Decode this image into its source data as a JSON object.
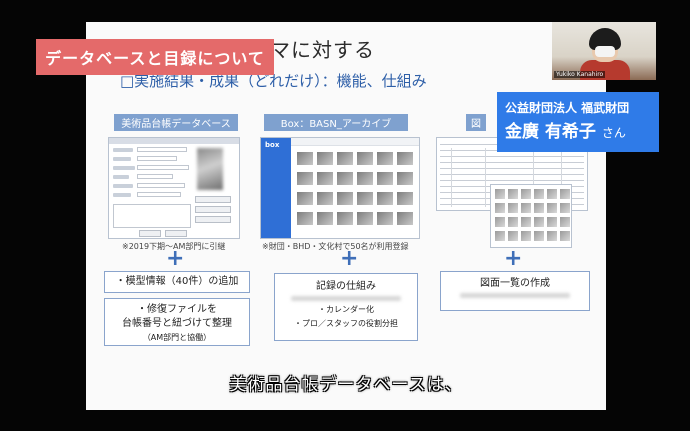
{
  "slide": {
    "title": "マに対する",
    "subtitle": "□実施結果・成果（どれだけ）：機能、仕組み"
  },
  "chapter_banner": "データベースと目録について",
  "columns": [
    {
      "label": "美術品台帳データベース",
      "note": "※2019下期〜AM部門に引継",
      "box1": "・模型情報（40件）の追加",
      "box2_line1": "・修復ファイルを",
      "box2_line2": "台帳番号と紐づけて整理",
      "box2_line3": "（AM部門と協働）"
    },
    {
      "label": "Box：BASN_アーカイブ",
      "note": "※財団・BHD・文化村で50名が利用登録",
      "box_title": "記録の仕組み",
      "box_line1": "・カレンダー化",
      "box_line2": "・プロ／スタッフの役割分担",
      "box_logo": "box"
    },
    {
      "label": "図",
      "box_title": "図面一覧の作成"
    }
  ],
  "plus_sign": "+",
  "caption": "美術品台帳データベースは、",
  "video": {
    "participant_name": "Yukiko Kanahiro"
  },
  "speaker": {
    "organization": "公益財団法人 福武財団",
    "name": "金廣 有希子",
    "honorific": "さん"
  },
  "colors": {
    "banner": "#e46a6a",
    "speaker_card": "#2f7be8",
    "subtitle": "#2e5fa8",
    "label_bg": "#7fa1cf"
  }
}
